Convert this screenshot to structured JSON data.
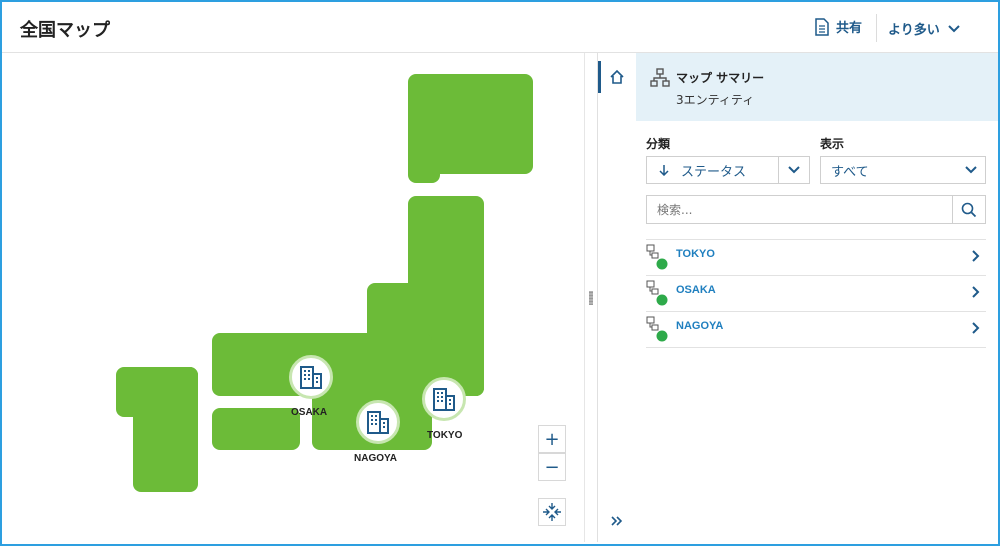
{
  "header": {
    "title": "全国マップ",
    "share_label": "共有",
    "more_label": "より多い"
  },
  "map": {
    "markers": [
      {
        "label": "OSAKA"
      },
      {
        "label": "NAGOYA"
      },
      {
        "label": "TOKYO"
      }
    ],
    "zoom_in": "+",
    "zoom_out": "−"
  },
  "panel": {
    "summary_title": "マップ サマリー",
    "summary_sub": "3エンティティ",
    "classify_label": "分類",
    "classify_value": "ステータス",
    "display_label": "表示",
    "display_value": "すべて",
    "search_placeholder": "検索...",
    "entities": [
      {
        "label": "TOKYO",
        "status_color": "#2eaa4a"
      },
      {
        "label": "OSAKA",
        "status_color": "#2eaa4a"
      },
      {
        "label": "NAGOYA",
        "status_color": "#2eaa4a"
      }
    ]
  },
  "colors": {
    "accent": "#1f5a8a",
    "land": "#6cbb38",
    "link": "#1f7fbf",
    "frame": "#2d9fe0"
  }
}
